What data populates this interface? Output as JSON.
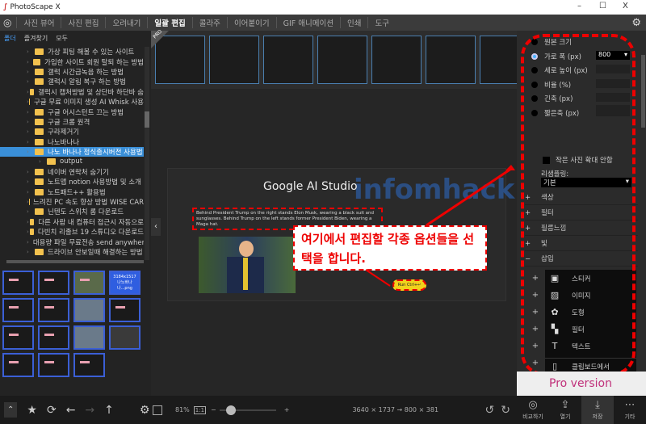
{
  "app": {
    "title": "PhotoScape X",
    "minimize": "–",
    "maximize": "☐",
    "close": "X"
  },
  "menu": {
    "items": [
      "사진 뷰어",
      "사진 편집",
      "오려내기",
      "일괄 편집",
      "콜라주",
      "이어붙이기",
      "GIF 애니메이션",
      "인쇄",
      "도구"
    ],
    "active_index": 3
  },
  "left": {
    "tabs": [
      "폴더",
      "즐겨찾기",
      "모두"
    ],
    "tree": [
      {
        "label": "가상 피팅 해볼 수 있는 사이트"
      },
      {
        "label": "가입한 사이트 회원 탈퇴 하는 방법"
      },
      {
        "label": "갤럭 시간급녹음 하는 방법"
      },
      {
        "label": "갤럭시 알림 복구 하는 방법"
      },
      {
        "label": "갤럭시 캡처방법 및 상단바 하단바 숨"
      },
      {
        "label": "구글 무료 이미지 생성 AI Whisk 사용"
      },
      {
        "label": "구글 어시스턴트 끄는 방법"
      },
      {
        "label": "구글 크롬 원격"
      },
      {
        "label": "구라제거기"
      },
      {
        "label": "나노바나나"
      },
      {
        "label": "나노 바나나 정식출시버전 사용법",
        "selected": true
      },
      {
        "label": "output",
        "sub": true
      },
      {
        "label": "네이버 연락처 숨기기"
      },
      {
        "label": "노트맵 notion 사용방법 및 소개"
      },
      {
        "label": "노트패드++ 활용법"
      },
      {
        "label": "느려진 PC 속도 향상 방법 WISE CAR"
      },
      {
        "label": "닌텐도 스위치 롬 다운로드"
      },
      {
        "label": "다른 사람 내 컴퓨터 접근시 자동으로"
      },
      {
        "label": "다빈치 리졸브 19 스튜디오 다운로드"
      },
      {
        "label": "대용량 파일 무료전송 send anywhere"
      },
      {
        "label": "드라이브 안보일때 해결하는 방법"
      }
    ],
    "thumb_badge": "3184x1517",
    "thumb_badge_name": "나노바나나...png"
  },
  "center": {
    "pro_badge": "PRO",
    "preview_title": "Google AI Studio",
    "watermark": "infomhack",
    "prompt_text": "Behind President Trump on the right stands Elon Musk, wearing a black suit and sunglasses. Behind Trump on the left stands former President Biden, wearing a Maga hat.",
    "callout": "여기에서 편집할 각종 옵션들을 선택을 합니다.",
    "run_label": "Run Ctrl+↵",
    "zoom": "81%",
    "one_to_one": "1:1",
    "zoom_minus": "−",
    "zoom_plus": "+",
    "zoom_fraction": 0.15,
    "dimensions": "3640 × 1737 → 800 × 381"
  },
  "right": {
    "resize_options": [
      {
        "label": "원본 크기"
      },
      {
        "label": "가로 폭 (px)",
        "value": "800",
        "selected": true
      },
      {
        "label": "세로 높이 (px)"
      },
      {
        "label": "비율 (%)"
      },
      {
        "label": "긴축 (px)"
      },
      {
        "label": "짧은축 (px)"
      }
    ],
    "no_enlarge": "작은 사진 확대 안함",
    "resampling_label": "리샘플링:",
    "resampling_value": "기본",
    "sections": [
      {
        "sign": "+",
        "label": "색상"
      },
      {
        "sign": "+",
        "label": "필터"
      },
      {
        "sign": "+",
        "label": "필름느낌"
      },
      {
        "sign": "+",
        "label": "빛"
      },
      {
        "sign": "−",
        "label": "삽입"
      }
    ],
    "insert_menu": [
      {
        "icon": "sticker-icon",
        "label": "스티커"
      },
      {
        "icon": "image-icon",
        "label": "이미지"
      },
      {
        "icon": "shape-icon",
        "label": "도형"
      },
      {
        "icon": "filter-icon",
        "label": "필터"
      },
      {
        "icon": "text-icon",
        "label": "텍스트"
      },
      {
        "icon": "clipboard-icon",
        "label": "클립보드에서"
      }
    ],
    "ad": "Pro version",
    "bottom": [
      {
        "label": "비교하기"
      },
      {
        "label": "열기"
      },
      {
        "label": "저장",
        "active": true
      },
      {
        "label": "기타"
      }
    ]
  }
}
